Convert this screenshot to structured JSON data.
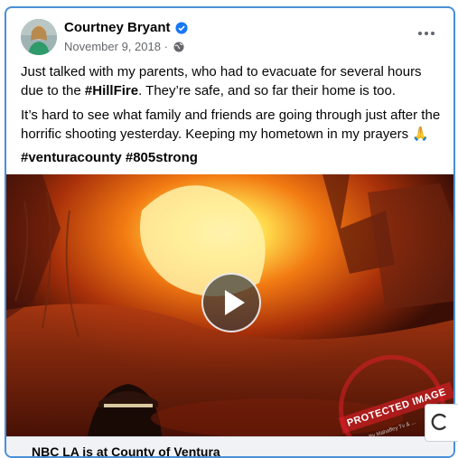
{
  "post": {
    "author": "Courtney Bryant",
    "date": "November 9, 2018 · ",
    "paragraph1_a": "Just talked with my parents, who had to evacuate for several hours due to the ",
    "paragraph1_tag": "#HillFire",
    "paragraph1_b": ". They’re safe, and so far their home is too.",
    "paragraph2": "It’s hard to see what family and friends are going through just after the horrific shooting yesterday. Keeping my hometown in my prayers 🙏",
    "hashtags": "#venturacounty #805strong",
    "watermark": "PROTECTED IMAGE",
    "watermark_sub": "By Mahaffey Tv & ...",
    "video_caption": "NBC LA is at County of Ventura"
  },
  "icons": {
    "verified": "verified-badge-icon",
    "audience": "globe-icon",
    "more": "more-options-icon",
    "play": "play-icon"
  },
  "colors": {
    "verified": "#1877f2",
    "card_border": "#4a8fd8",
    "watermark": "#dc1e28"
  }
}
